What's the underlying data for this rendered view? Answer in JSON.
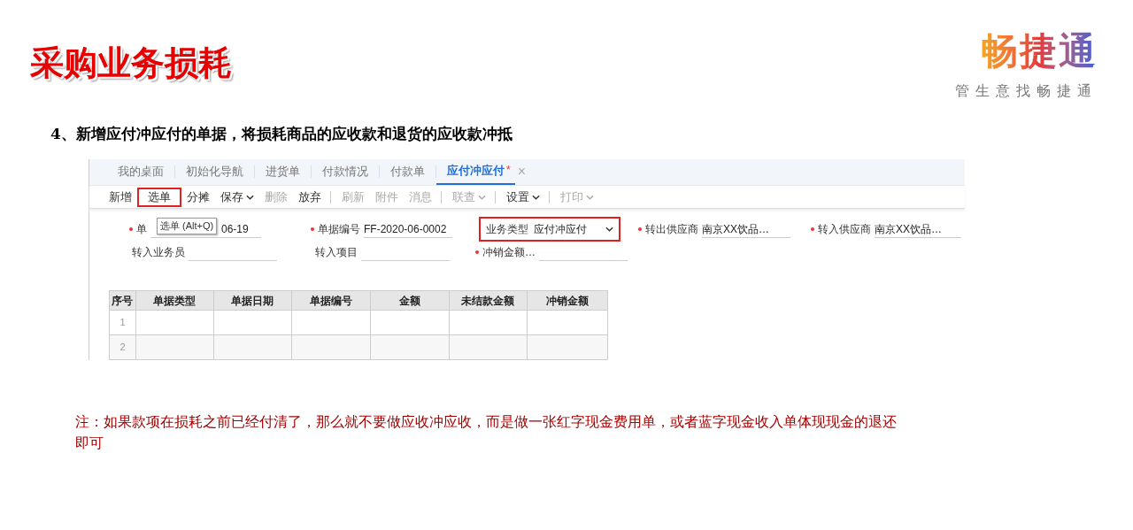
{
  "title": "采购业务损耗",
  "logo": {
    "name": "畅捷通",
    "slogan": "管生意找畅捷通"
  },
  "step": "4、新增应付冲应付的单据，将损耗商品的应收款和退货的应收款冲抵",
  "app": {
    "tabs": [
      {
        "label": "我的桌面",
        "selected": false
      },
      {
        "label": "初始化导航",
        "selected": false
      },
      {
        "label": "进货单",
        "selected": false
      },
      {
        "label": "付款情况",
        "selected": false
      },
      {
        "label": "付款单",
        "selected": false
      },
      {
        "label": "应付冲应付",
        "selected": true,
        "flag": "*",
        "close": "×"
      }
    ],
    "toolbar": [
      {
        "label": "新增",
        "disabled": false,
        "dropdown": false,
        "highlighted": false,
        "divider_after": false
      },
      {
        "label": "选单",
        "disabled": false,
        "dropdown": false,
        "highlighted": true,
        "divider_after": false
      },
      {
        "label": "分摊",
        "disabled": false,
        "dropdown": false,
        "highlighted": false,
        "divider_after": false
      },
      {
        "label": "保存",
        "disabled": false,
        "dropdown": true,
        "highlighted": false,
        "divider_after": false
      },
      {
        "label": "删除",
        "disabled": true,
        "dropdown": false,
        "highlighted": false,
        "divider_after": false
      },
      {
        "label": "放弃",
        "disabled": false,
        "dropdown": false,
        "highlighted": false,
        "divider_after": true
      },
      {
        "label": "刷新",
        "disabled": true,
        "dropdown": false,
        "highlighted": false,
        "divider_after": false
      },
      {
        "label": "附件",
        "disabled": true,
        "dropdown": false,
        "highlighted": false,
        "divider_after": false
      },
      {
        "label": "消息",
        "disabled": true,
        "dropdown": false,
        "highlighted": false,
        "divider_after": true
      },
      {
        "label": "联查",
        "disabled": true,
        "dropdown": true,
        "highlighted": false,
        "divider_after": true
      },
      {
        "label": "设置",
        "disabled": false,
        "dropdown": true,
        "highlighted": false,
        "divider_after": true
      },
      {
        "label": "打印",
        "disabled": true,
        "dropdown": true,
        "highlighted": false,
        "divider_after": false
      }
    ],
    "tooltip": "选单 (Alt+Q)",
    "form_rows": [
      [
        {
          "kind": "text",
          "label": "单",
          "required": true,
          "value": "06-19",
          "highlighted": false
        },
        {
          "kind": "text",
          "label": "单据编号",
          "required": true,
          "value": "FF-2020-06-0002",
          "highlighted": false
        },
        {
          "kind": "select",
          "label": "业务类型",
          "value": "应付冲应付",
          "highlighted": true
        },
        {
          "kind": "text",
          "label": "转出供应商",
          "required": true,
          "value": "南京XX饮品…",
          "highlighted": false
        },
        {
          "kind": "text",
          "label": "转入供应商",
          "required": true,
          "value": "南京XX饮品…",
          "highlighted": false
        }
      ],
      [
        {
          "kind": "text",
          "label": "转入业务员",
          "required": false,
          "highlighted": false
        },
        {
          "kind": "text",
          "label": "转入项目",
          "required": false,
          "highlighted": false
        },
        {
          "kind": "text",
          "label": "冲销金额…",
          "required": true,
          "highlighted": false
        }
      ]
    ],
    "table": {
      "columns": [
        "序号",
        "单据类型",
        "单据日期",
        "单据编号",
        "金额",
        "未结款金额",
        "冲销金额"
      ],
      "rows": [
        "1",
        "2"
      ]
    }
  },
  "note": "注：如果款项在损耗之前已经付清了，那么就不要做应收冲应收，而是做一张红字现金费用单，或者蓝字现金收入单体现现金的退还即可"
}
